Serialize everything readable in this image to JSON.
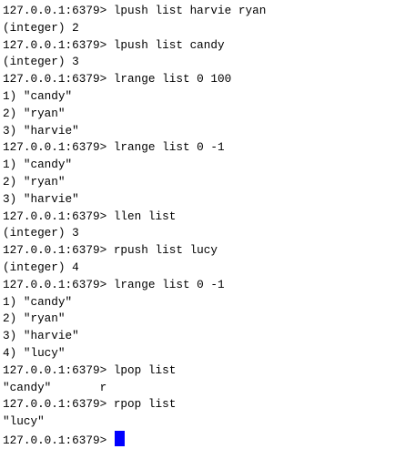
{
  "terminal": {
    "lines": [
      "127.0.0.1:6379> lpush list harvie ryan",
      "(integer) 2",
      "127.0.0.1:6379> lpush list candy",
      "(integer) 3",
      "127.0.0.1:6379> lrange list 0 100",
      "1) \"candy\"",
      "2) \"ryan\"",
      "3) \"harvie\"",
      "127.0.0.1:6379> lrange list 0 -1",
      "1) \"candy\"",
      "2) \"ryan\"",
      "3) \"harvie\"",
      "127.0.0.1:6379> llen list",
      "(integer) 3",
      "127.0.0.1:6379> rpush list lucy",
      "(integer) 4",
      "127.0.0.1:6379> lrange list 0 -1",
      "1) \"candy\"",
      "2) \"ryan\"",
      "3) \"harvie\"",
      "4) \"lucy\"",
      "127.0.0.1:6379> lpop list",
      "\"candy\"       r",
      "127.0.0.1:6379> rpop list",
      "\"lucy\""
    ],
    "prompt": "127.0.0.1:6379> ",
    "colors": {
      "background": "#ffffff",
      "text": "#000000",
      "cursor": "#0000ff"
    }
  }
}
